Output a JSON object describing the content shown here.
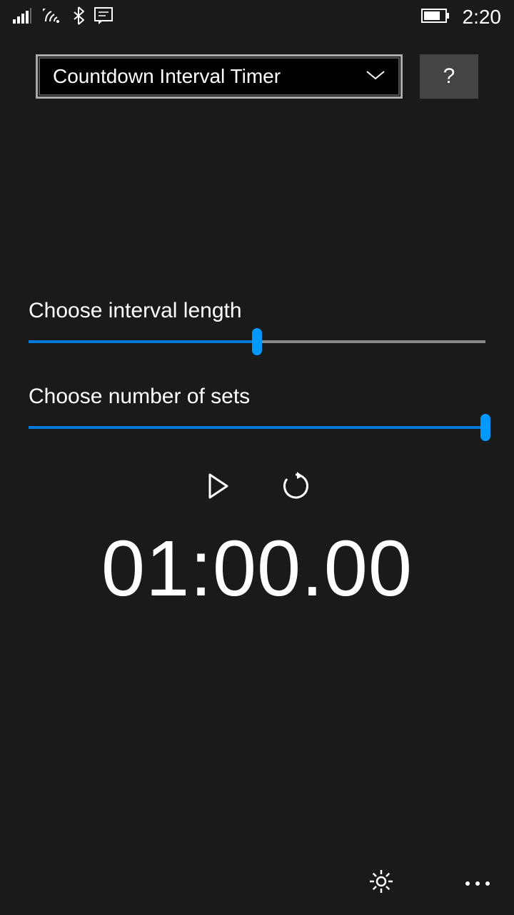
{
  "status": {
    "time": "2:20"
  },
  "header": {
    "dropdown_label": "Countdown Interval Timer",
    "help_label": "?"
  },
  "sliders": {
    "interval": {
      "label": "Choose interval length",
      "percent": 50
    },
    "sets": {
      "label": "Choose number of sets",
      "percent": 100
    }
  },
  "timer": {
    "display": "01:00.00"
  },
  "colors": {
    "accent": "#0078d7",
    "thumb": "#0099ff"
  }
}
